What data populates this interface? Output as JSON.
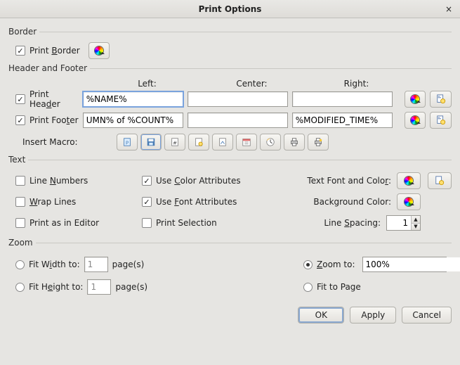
{
  "window": {
    "title": "Print Options",
    "close_char": "×"
  },
  "border": {
    "section_label": "Border",
    "print_border_label_pre": "Print ",
    "print_border_label_u": "B",
    "print_border_label_post": "order",
    "print_border_checked": true
  },
  "hf": {
    "section_label": "Header and Footer",
    "col_left": "Left:",
    "col_center": "Center:",
    "col_right": "Right:",
    "header_label_pre": "Print Hea",
    "header_label_u": "d",
    "header_label_post": "er",
    "header_checked": true,
    "header_left_value": "%NAME%",
    "header_center_value": "",
    "header_right_value": "",
    "footer_label_pre": "Print Foo",
    "footer_label_u": "t",
    "footer_label_post": "er",
    "footer_checked": true,
    "footer_left_value": "UMN% of %COUNT%",
    "footer_center_value": "",
    "footer_right_value": "%MODIFIED_TIME%",
    "insert_macro_label": "Insert Macro:"
  },
  "text": {
    "section_label": "Text",
    "line_numbers_pre": "Line ",
    "line_numbers_u": "N",
    "line_numbers_post": "umbers",
    "line_numbers_checked": false,
    "wrap_lines_u": "W",
    "wrap_lines_post": "rap Lines",
    "wrap_lines_checked": false,
    "print_as_editor": "Print as in Editor",
    "print_as_editor_checked": false,
    "use_color_pre": "Use ",
    "use_color_u": "C",
    "use_color_post": "olor Attributes",
    "use_color_checked": true,
    "use_font_pre": "Use ",
    "use_font_u": "F",
    "use_font_post": "ont Attributes",
    "use_font_checked": true,
    "print_selection": "Print Selection",
    "print_selection_checked": false,
    "text_font_color_pre": "Text Font and Colo",
    "text_font_color_u": "r",
    "text_font_color_post": ":",
    "background_color": "Background Color:",
    "line_spacing_pre": "Line ",
    "line_spacing_u": "S",
    "line_spacing_post": "pacing:",
    "line_spacing_value": "1"
  },
  "zoom": {
    "section_label": "Zoom",
    "fit_width_pre": "Fit W",
    "fit_width_u": "i",
    "fit_width_post": "dth to:",
    "fit_width_selected": false,
    "fit_width_value": "1",
    "fit_height_pre": "Fit H",
    "fit_height_u": "e",
    "fit_height_post": "ight to:",
    "fit_height_selected": false,
    "fit_height_value": "1",
    "pages_label": "page(s)",
    "zoom_to_u": "Z",
    "zoom_to_post": "oom to:",
    "zoom_to_selected": true,
    "zoom_to_value": "100%",
    "fit_to_page": "Fit to Page",
    "fit_to_page_selected": false
  },
  "buttons": {
    "ok": "OK",
    "apply": "Apply",
    "cancel": "Cancel"
  }
}
